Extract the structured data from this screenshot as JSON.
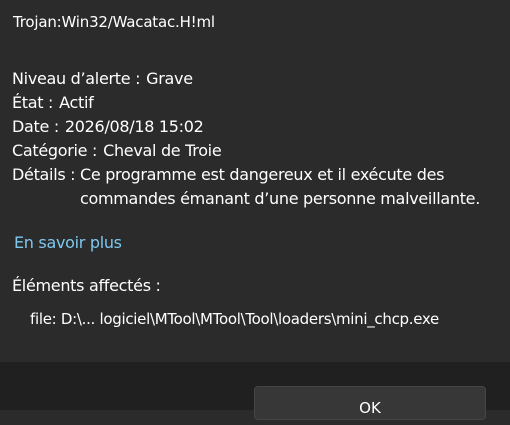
{
  "threat": {
    "name": "Trojan:Win32/Wacatac.H!ml"
  },
  "fields": {
    "alert_level_label": "Niveau d’alerte :",
    "alert_level_value": "Grave",
    "status_label": "État :",
    "status_value": "Actif",
    "date_label": "Date :",
    "date_value": "2026/08/18 15:02",
    "category_label": "Catégorie :",
    "category_value": "Cheval de Troie",
    "details_label": "Détails :",
    "details_value": "Ce programme est dangereux et il exécute des commandes émanant d’une personne malveillante."
  },
  "learn_more": "En savoir plus",
  "affected": {
    "heading": "Éléments affectés :",
    "items": [
      "file: D:\\... logiciel\\MTool\\MTool\\Tool\\loaders\\mini_chcp.exe"
    ]
  },
  "footer": {
    "ok_label": "OK"
  },
  "colors": {
    "background": "#2b2b2b",
    "footer_background": "#202020",
    "link": "#7ec8f0",
    "text": "#ffffff"
  }
}
